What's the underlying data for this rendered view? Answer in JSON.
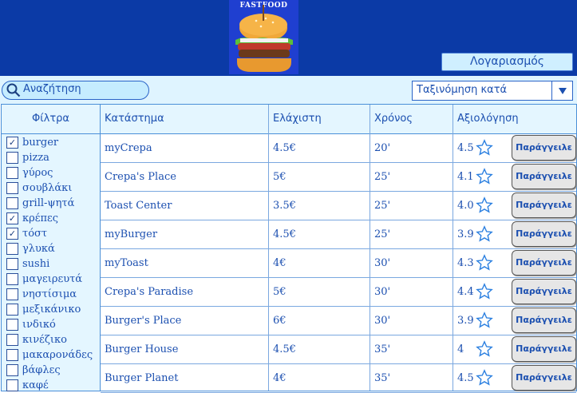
{
  "brand": {
    "logo_text": "FASTFOOD"
  },
  "header": {
    "account_label": "Λογαριασμός"
  },
  "search": {
    "label": "Αναζήτηση"
  },
  "sort": {
    "label": "Ταξινόμηση κατά"
  },
  "filters": {
    "title": "Φίλτρα",
    "items": [
      {
        "label": "burger",
        "checked": true
      },
      {
        "label": "pizza",
        "checked": false
      },
      {
        "label": "γύρος",
        "checked": false
      },
      {
        "label": "σουβλάκι",
        "checked": false
      },
      {
        "label": "grill-ψητά",
        "checked": false
      },
      {
        "label": "κρέπες",
        "checked": true
      },
      {
        "label": "τόστ",
        "checked": true
      },
      {
        "label": "γλυκά",
        "checked": false
      },
      {
        "label": "sushi",
        "checked": false
      },
      {
        "label": "μαγειρευτά",
        "checked": false
      },
      {
        "label": "νηστίσιμα",
        "checked": false
      },
      {
        "label": "μεξικάνικο",
        "checked": false
      },
      {
        "label": "ινδικό",
        "checked": false
      },
      {
        "label": "κινέζικο",
        "checked": false
      },
      {
        "label": "μακαρονάδες",
        "checked": false
      },
      {
        "label": "βάφλες",
        "checked": false
      },
      {
        "label": "καφέ",
        "checked": false
      }
    ]
  },
  "table": {
    "headers": [
      "Κατάστημα",
      "Ελάχιστη",
      "Χρόνος",
      "Αξιολόγηση"
    ],
    "order_label": "Παράγγειλε",
    "rows": [
      {
        "name": "myCrepa",
        "min": "4.5€",
        "time": "20'",
        "rating": "4.5"
      },
      {
        "name": "Crepa's Place",
        "min": "5€",
        "time": "25'",
        "rating": "4.1"
      },
      {
        "name": "Toast Center",
        "min": "3.5€",
        "time": "25'",
        "rating": "4.0"
      },
      {
        "name": "myBurger",
        "min": "4.5€",
        "time": "25'",
        "rating": "3.9"
      },
      {
        "name": "myToast",
        "min": "4€",
        "time": "30'",
        "rating": "4.3"
      },
      {
        "name": "Crepa's Paradise",
        "min": "5€",
        "time": "30'",
        "rating": "4.4"
      },
      {
        "name": "Burger's Place",
        "min": "6€",
        "time": "30'",
        "rating": "3.9"
      },
      {
        "name": "Burger House",
        "min": "4.5€",
        "time": "35'",
        "rating": "4"
      },
      {
        "name": "Burger Planet",
        "min": "4€",
        "time": "35'",
        "rating": "4.5"
      }
    ]
  },
  "colors": {
    "header_bg": "#0b3aa6",
    "accent": "#1b4fb0",
    "panel_bg": "#e4f6ff"
  }
}
